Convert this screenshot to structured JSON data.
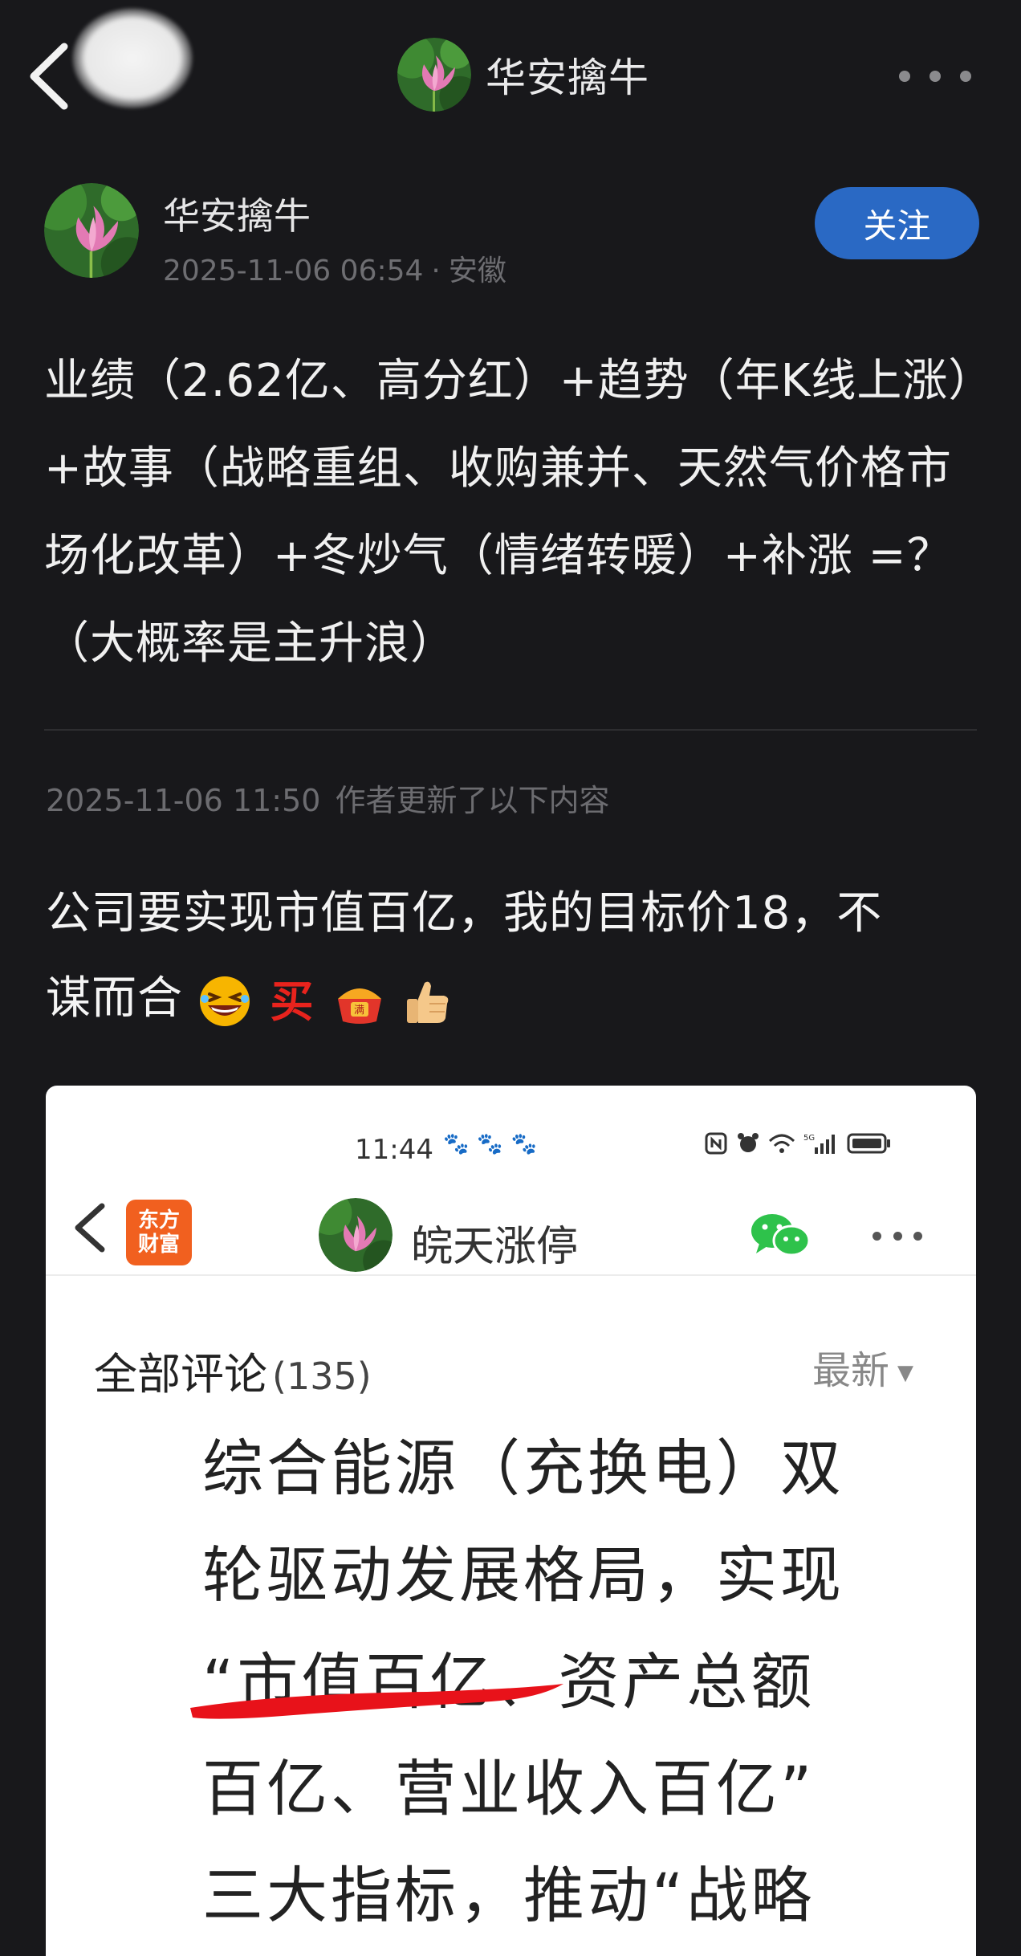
{
  "nav": {
    "title": "华安擒牛"
  },
  "author": {
    "name": "华安擒牛",
    "datetime": "2025-11-06 06:54",
    "location": "安徽",
    "follow_label": "关注"
  },
  "post": {
    "text": "业绩（2.62亿、高分红）+趋势（年K线上涨）+故事（战略重组、收购兼并、天然气价格市场化改革）+冬炒气（情绪转暖）+补涨 =？（大概率是主升浪）"
  },
  "update": {
    "datetime": "2025-11-06 11:50",
    "notice": "作者更新了以下内容",
    "text_line1": "公司要实现市值百亿，我的目标价18，不",
    "text_line2": "谋而合",
    "emoji_buy_label": "买",
    "emoji_full_label": "满"
  },
  "screenshot": {
    "status_time": "11:44",
    "app_logo_line1": "东方",
    "app_logo_line2": "财富",
    "header_title": "皖天涨停",
    "comments_label": "全部评论",
    "comments_count": "(135)",
    "sort_label": "最新",
    "body_lines": [
      "综合能源（充换电）双",
      "轮驱动发展格局，实现",
      "“市值百亿、资产总额",
      "百亿、营业收入百亿”",
      "三大指标，推动“战略"
    ]
  },
  "icons": {
    "back": "chevron-left-icon",
    "more": "more-dots-icon",
    "wechat": "wechat-icon"
  },
  "colors": {
    "background": "#18181b",
    "follow_button": "#2a69c4",
    "logo_orange": "#f1601f",
    "underline_red": "#e8121a"
  }
}
